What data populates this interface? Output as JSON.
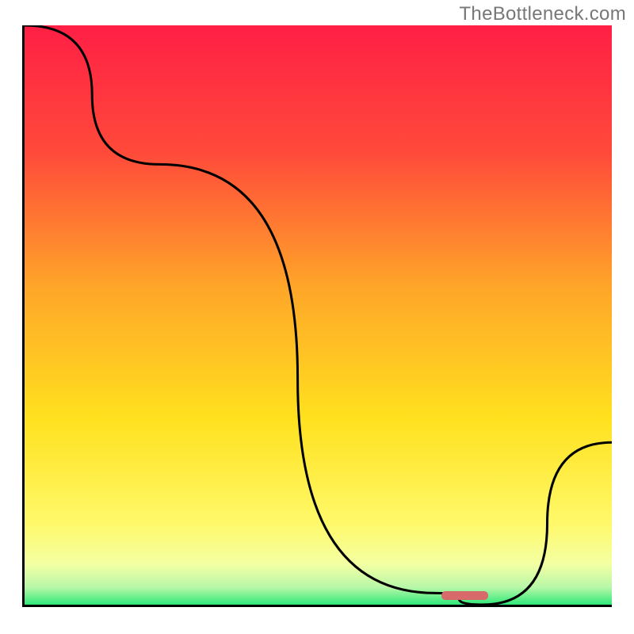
{
  "watermark": "TheBottleneck.com",
  "chart_data": {
    "type": "line",
    "title": "",
    "xlabel": "",
    "ylabel": "",
    "xlim": [
      0,
      100
    ],
    "ylim": [
      0,
      100
    ],
    "series": [
      {
        "name": "bottleneck-curve",
        "x": [
          0,
          23,
          70,
          78,
          100
        ],
        "y": [
          100,
          76,
          2,
          0,
          28
        ]
      }
    ],
    "highlight_range_x": [
      71,
      79
    ],
    "background_gradient": [
      {
        "stop": 0.0,
        "color": "#ff1f45"
      },
      {
        "stop": 0.22,
        "color": "#ff4a3a"
      },
      {
        "stop": 0.45,
        "color": "#ffa529"
      },
      {
        "stop": 0.68,
        "color": "#ffe11e"
      },
      {
        "stop": 0.86,
        "color": "#fff96a"
      },
      {
        "stop": 0.93,
        "color": "#f3ffa3"
      },
      {
        "stop": 0.97,
        "color": "#b8f7a8"
      },
      {
        "stop": 1.0,
        "color": "#2fe978"
      }
    ]
  }
}
